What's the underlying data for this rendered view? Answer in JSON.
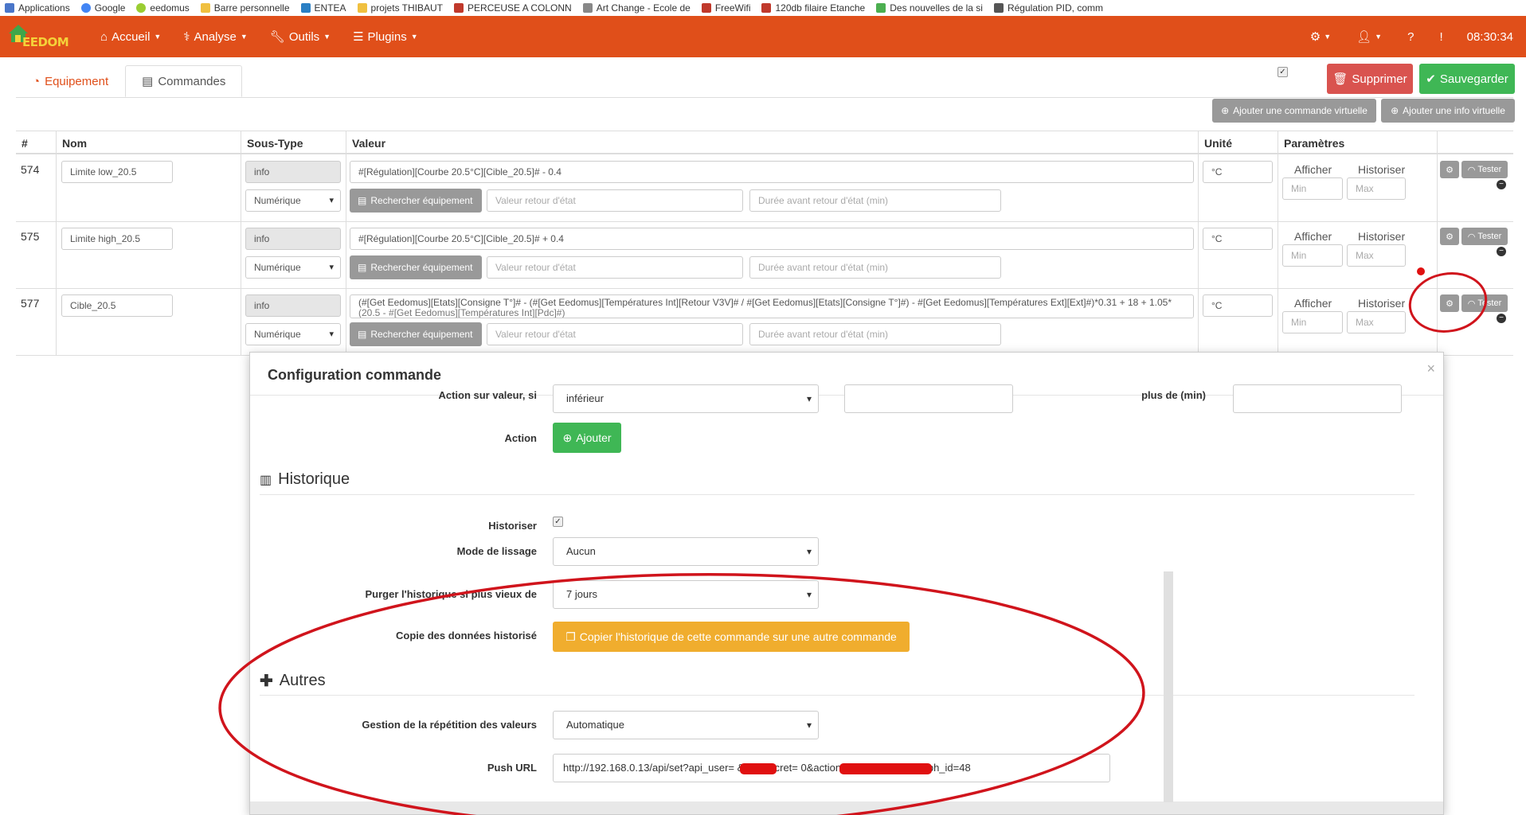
{
  "bookmarks": [
    {
      "label": "Applications",
      "color": "#4a76c9"
    },
    {
      "label": "Google",
      "color": "#4285f4"
    },
    {
      "label": "eedomus",
      "color": "#9acd32"
    },
    {
      "label": "Barre personnelle",
      "color": "#f0c040"
    },
    {
      "label": "ENTEA",
      "color": "#2a7fc4"
    },
    {
      "label": "projets THIBAUT",
      "color": "#f0c040"
    },
    {
      "label": "PERCEUSE A COLONN",
      "color": "#c0392b"
    },
    {
      "label": "Art Change - Ecole de",
      "color": "#888888"
    },
    {
      "label": "FreeWifi",
      "color": "#c0392b"
    },
    {
      "label": "120db filaire Etanche",
      "color": "#c0392b"
    },
    {
      "label": "Des nouvelles de la si",
      "color": "#4caf50"
    },
    {
      "label": "Régulation PID, comm",
      "color": "#555555"
    }
  ],
  "navbar": {
    "brand": "EEDOM",
    "menu": [
      "Accueil",
      "Analyse",
      "Outils",
      "Plugins"
    ],
    "time": "08:30:34",
    "color": "#e04f1a"
  },
  "tabs": {
    "equipement": "Equipement",
    "commandes": "Commandes"
  },
  "actions": {
    "delete": "Supprimer",
    "save": "Sauvegarder",
    "add_virtual_cmd": "Ajouter une commande virtuelle",
    "add_virtual_info": "Ajouter une info virtuelle"
  },
  "table": {
    "headers": [
      "#",
      "Nom",
      "Sous-Type",
      "Valeur",
      "Unité",
      "Paramètres"
    ],
    "rows": [
      {
        "id": "574",
        "name": "Limite low_20.5",
        "type": "info",
        "subtype": "Numérique",
        "value": "#[Régulation][Courbe 20.5°C][Cible_20.5]# - 0.4",
        "value2": "",
        "unit": "°C"
      },
      {
        "id": "575",
        "name": "Limite high_20.5",
        "type": "info",
        "subtype": "Numérique",
        "value": "#[Régulation][Courbe 20.5°C][Cible_20.5]# + 0.4",
        "value2": "",
        "unit": "°C"
      },
      {
        "id": "577",
        "name": "Cible_20.5",
        "type": "info",
        "subtype": "Numérique",
        "value": "(#[Get Eedomus][Etats][Consigne T°]# - (#[Get Eedomus][Températures Int][Retour V3V]# / #[Get Eedomus][Etats][Consigne T°]#) - #[Get Eedomus][Températures Ext][Ext]#)*0.31 + 18 + 1.05*",
        "value2": "(20.5 - #[Get Eedomus][Températures Int][Pdc]#)",
        "unit": "°C"
      }
    ],
    "search_btn": "Rechercher équipement",
    "return_placeholder": "Valeur retour d'état",
    "duration_placeholder": "Durée avant retour d'état (min)",
    "afficher": "Afficher",
    "historiser": "Historiser",
    "min_placeholder": "Min",
    "max_placeholder": "Max",
    "tester": "Tester"
  },
  "modal": {
    "title": "Configuration commande",
    "close": "×",
    "action_sur_valeur_label": "Action sur valeur, si",
    "action_sur_valeur_value": "inférieur",
    "plus_de_label": "plus de (min)",
    "action_label": "Action",
    "ajouter": "Ajouter",
    "historique_title": "Historique",
    "historiser_label": "Historiser",
    "lissage_label": "Mode de lissage",
    "lissage_value": "Aucun",
    "purger_label": "Purger l'historique si plus vieux de",
    "purger_value": "7 jours",
    "copie_label": "Copie des données historisé",
    "copie_btn": "Copier l'historique de cette commande sur une autre commande",
    "autres_title": "Autres",
    "repetition_label": "Gestion de la répétition des valeurs",
    "repetition_value": "Automatique",
    "push_label": "Push URL",
    "push_value": "http://192.168.0.13/api/set?api_user=            &api_secret=                            0&action=periph.value&periph_id=48"
  },
  "colors": {
    "green": "#3fb755",
    "red": "#d9534f",
    "gray": "#999999",
    "orange_btn": "#f0ad2e",
    "annotation": "#d0141c"
  }
}
